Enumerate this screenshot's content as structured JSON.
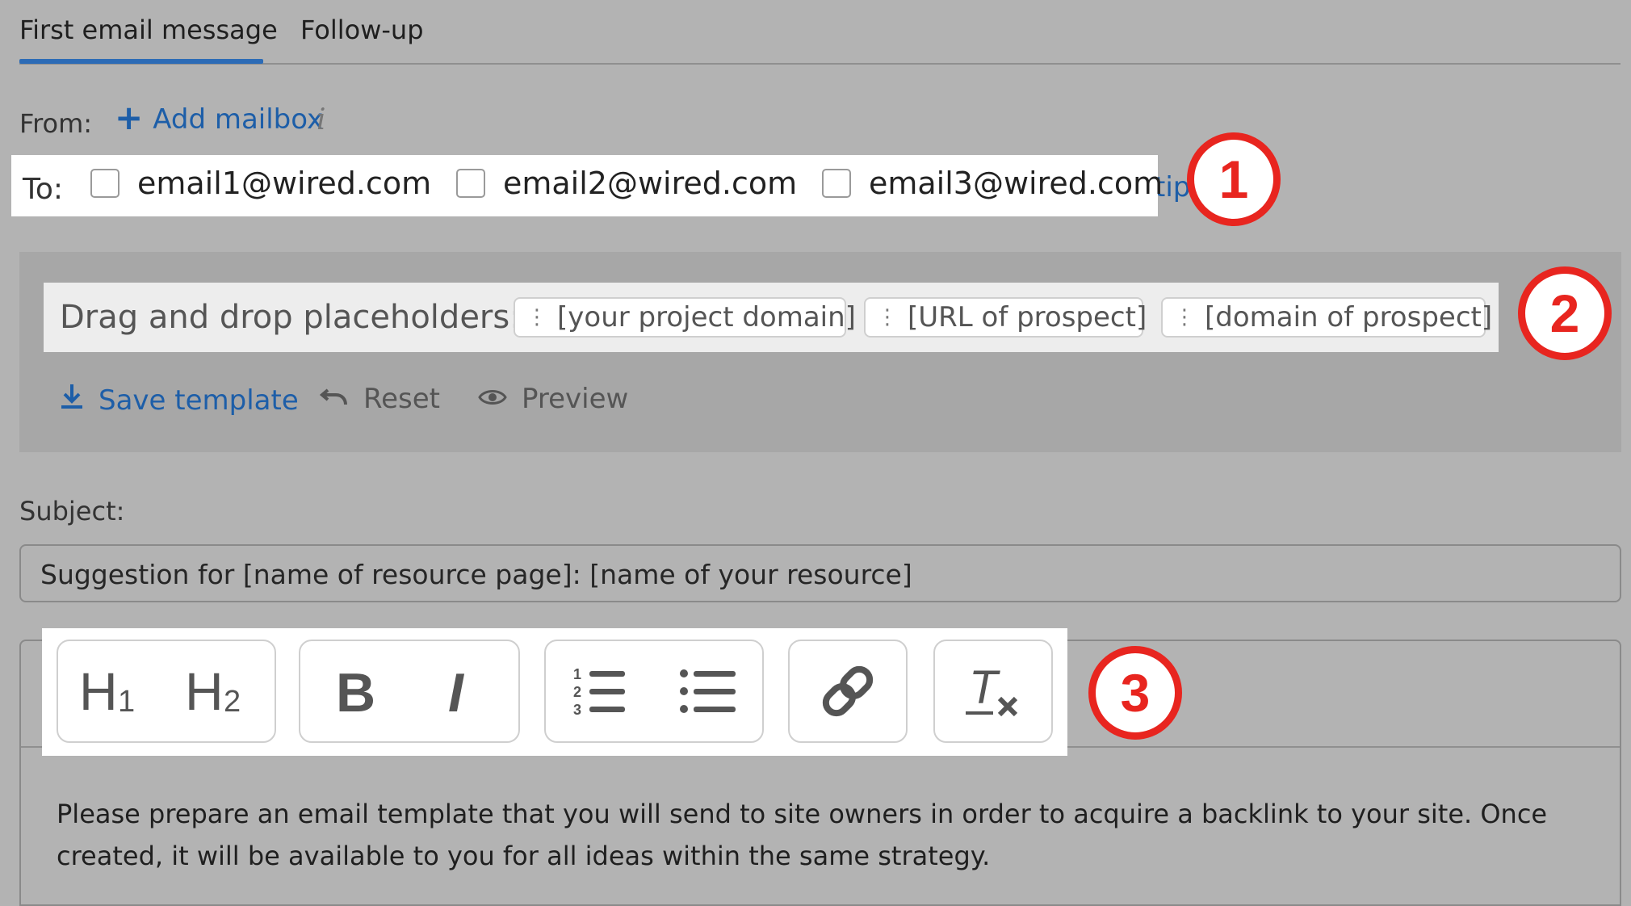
{
  "tabs": {
    "first": "First email message",
    "followup": "Follow-up"
  },
  "from": {
    "label": "From:",
    "add_mailbox": "Add mailbox",
    "info": "i"
  },
  "to": {
    "label": "To:",
    "emails": [
      "email1@wired.com",
      "email2@wired.com",
      "email3@wired.com"
    ],
    "partial_link": "tip"
  },
  "badges": [
    "1",
    "2",
    "3"
  ],
  "placeholders": {
    "label": "Drag and drop placeholders:",
    "chips": [
      "[your project domain]",
      "[URL of prospect]",
      "[domain of prospect]"
    ]
  },
  "actions": {
    "save": "Save template",
    "reset": "Reset",
    "preview": "Preview"
  },
  "subject": {
    "label": "Subject:",
    "value": "Suggestion for [name of resource page]: [name of your resource]"
  },
  "editor": {
    "text": "Please prepare an email template that you will send to site owners in order to acquire a backlink to your site. Once created, it will be available to you for all ideas within the same strategy."
  },
  "colors": {
    "accent": "#1d5ea8",
    "badge": "#e8251f",
    "tab_underline": "#2c6bb6"
  }
}
